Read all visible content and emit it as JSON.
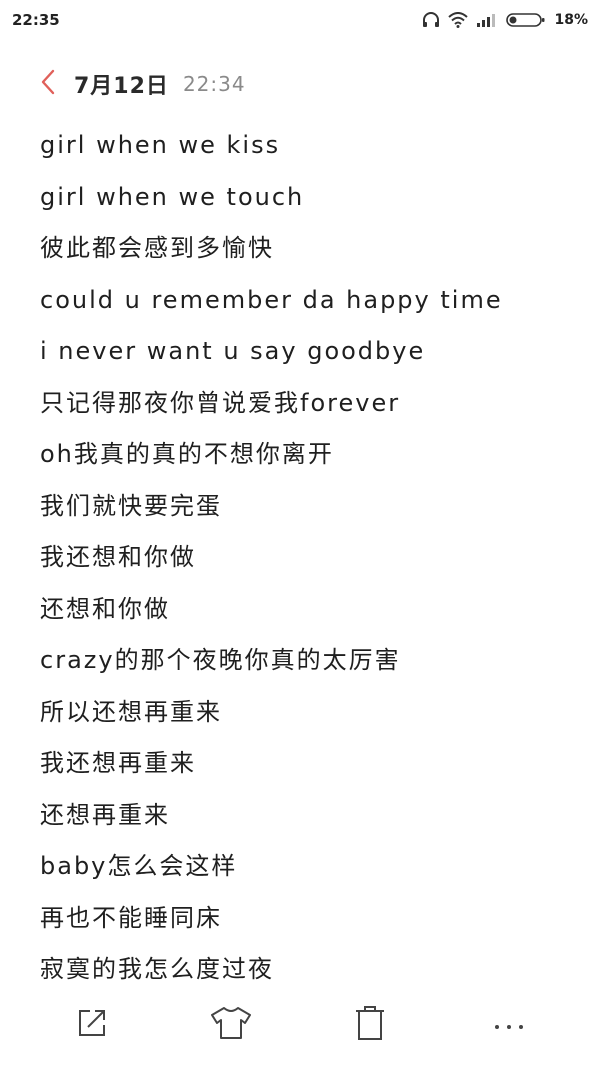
{
  "status_bar": {
    "time": "22:35",
    "battery_percent": "18%",
    "icons": [
      "headphones-icon",
      "wifi-icon",
      "signal-icon",
      "battery-icon"
    ]
  },
  "header": {
    "back_icon": "chevron-left-icon",
    "date": "7月12日",
    "time": "22:34",
    "accent_color": "#e0605a"
  },
  "note": {
    "lines": [
      "girl when we kiss",
      "girl when we touch",
      "彼此都会感到多愉快",
      "could u remember da happy time",
      "i never want u say goodbye",
      "只记得那夜你曾说爱我forever",
      "oh我真的真的不想你离开",
      "我们就快要完蛋",
      "我还想和你做",
      "还想和你做",
      "crazy的那个夜晚你真的太厉害",
      "所以还想再重来",
      "我还想再重来",
      "还想再重来",
      "baby怎么会这样",
      "再也不能睡同床",
      "寂寞的我怎么度过夜"
    ]
  },
  "toolbar": {
    "items": [
      "share-icon",
      "theme-shirt-icon",
      "delete-icon",
      "more-icon"
    ]
  }
}
